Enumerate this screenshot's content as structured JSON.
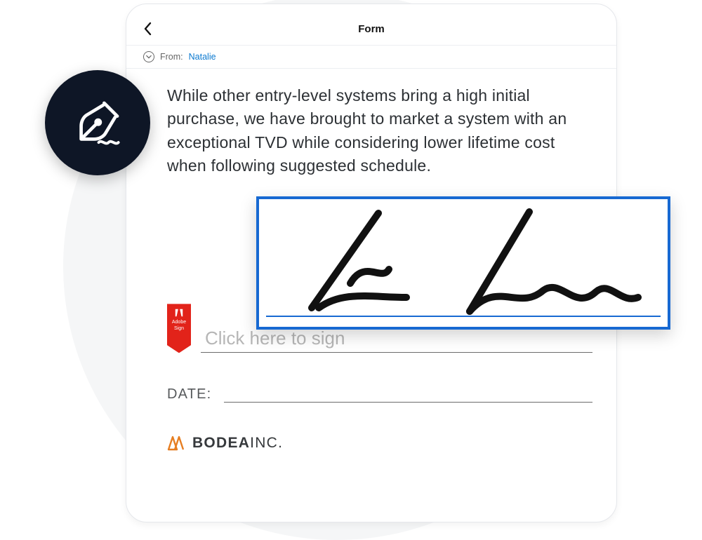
{
  "nav": {
    "title": "Form"
  },
  "from": {
    "label": "From:",
    "sender": "Natalie"
  },
  "doc": {
    "paragraph": "While other entry-level systems bring a high initial purchase, we have brought to market a system with an exceptional TVD while considering lower lifetime cost when following suggested schedule."
  },
  "signature": {
    "placeholder": "Click here to sign",
    "adobe_label1": "Adobe",
    "adobe_label2": "Sign"
  },
  "date": {
    "label": "DATE:"
  },
  "brand": {
    "bold": "BODEA",
    "rest": "INC."
  },
  "colors": {
    "accent_blue": "#1769d2",
    "adobe_red": "#e2231a",
    "badge": "#0e1626"
  }
}
